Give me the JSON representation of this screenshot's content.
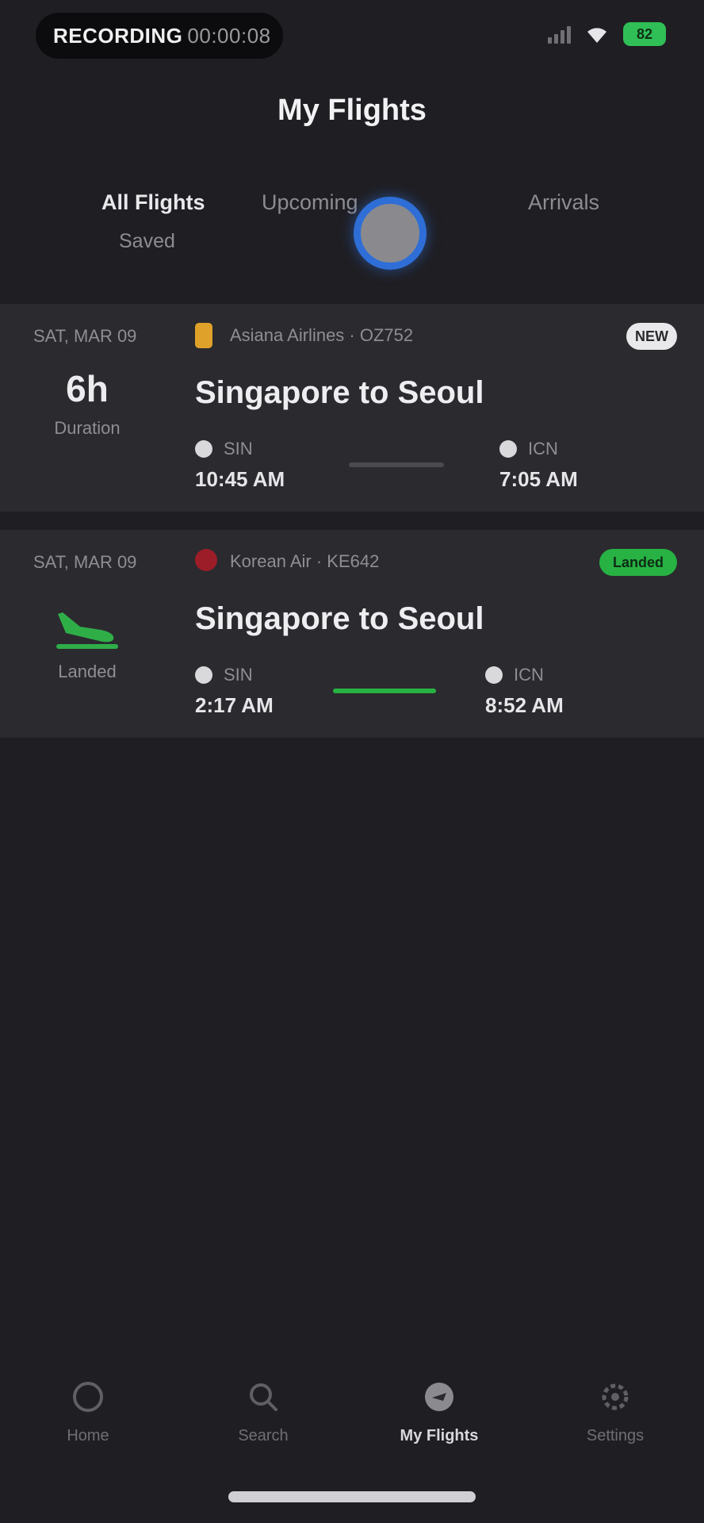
{
  "status_bar": {
    "carrier": "RECORDING",
    "carrier_sub": "00:00:08",
    "battery": "82"
  },
  "page": {
    "title": "My Flights"
  },
  "tabs": [
    {
      "label": "All Flights",
      "sub": "Saved",
      "active": true
    },
    {
      "label": "Upcoming",
      "active": false
    },
    {
      "label": "Arrivals",
      "active": false
    }
  ],
  "flights": [
    {
      "date": "SAT, MAR 09",
      "airline": "Asiana Airlines",
      "flight_no": "OZ752",
      "badge": "NEW",
      "left_value": "6h",
      "left_label": "Duration",
      "route": "Singapore to Seoul",
      "depart_code": "SIN",
      "depart_time": "10:45 AM",
      "arrive_code": "ICN",
      "arrive_time": "7:05 AM",
      "progress": 0
    },
    {
      "date": "SAT, MAR 09",
      "airline": "Korean Air",
      "flight_no": "KE642",
      "badge": "Landed",
      "left_value": "",
      "left_label": "Landed",
      "route": "Singapore to Seoul",
      "depart_code": "SIN",
      "depart_time": "2:17 AM",
      "arrive_code": "ICN",
      "arrive_time": "8:52 AM",
      "progress": 1
    }
  ],
  "bottom_nav": [
    {
      "label": "Home",
      "icon": "home-icon",
      "active": false
    },
    {
      "label": "Search",
      "icon": "search-icon",
      "active": false
    },
    {
      "label": "My Flights",
      "icon": "plane-icon",
      "active": true
    },
    {
      "label": "Settings",
      "icon": "gear-icon",
      "active": false
    }
  ],
  "colors": {
    "background": "#1f1e22",
    "card": "#2b2a2f",
    "accent_green": "#27b243",
    "touch_blue": "#2e6ed6"
  }
}
